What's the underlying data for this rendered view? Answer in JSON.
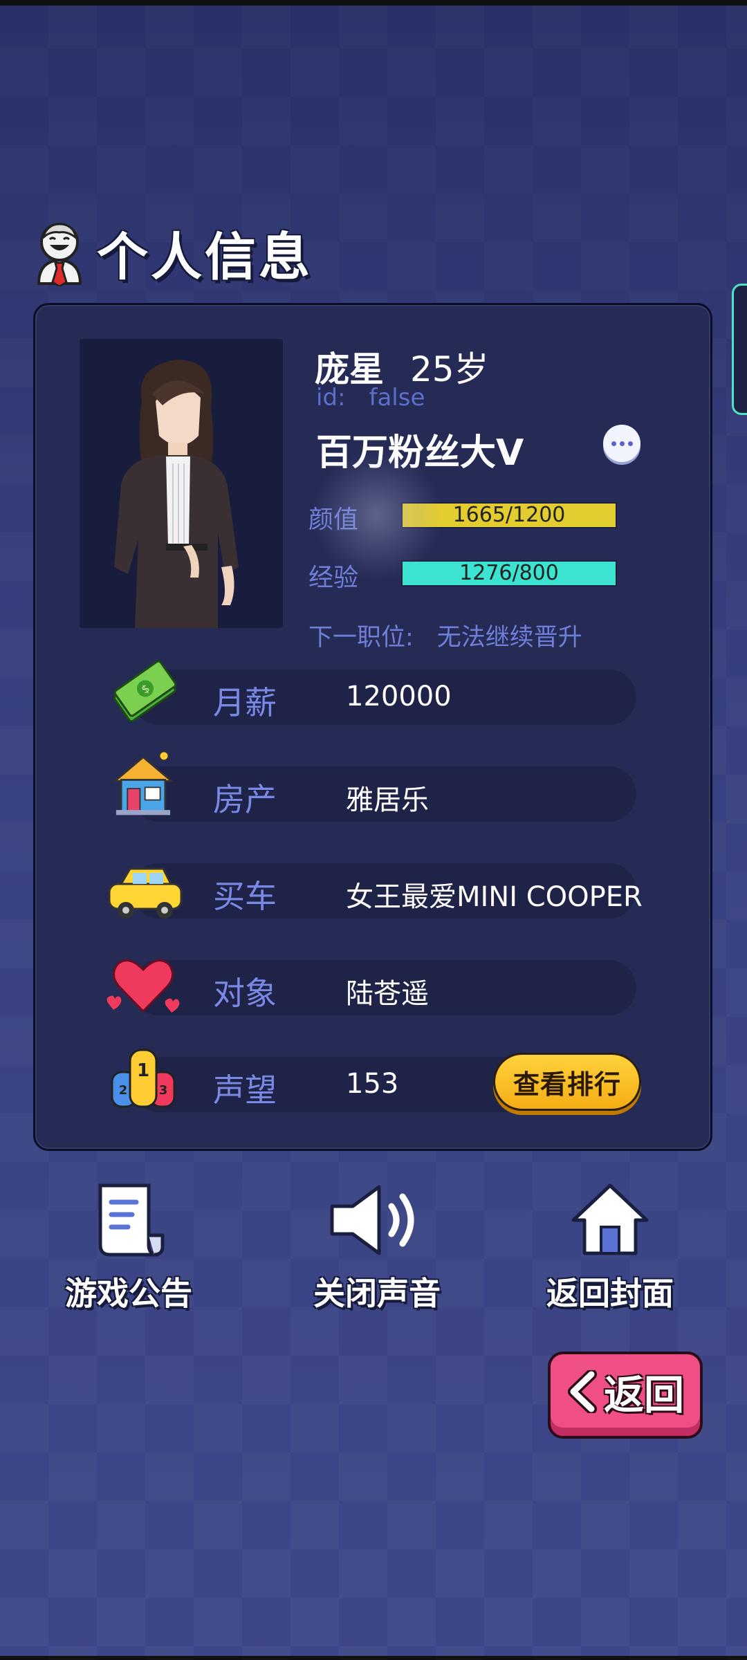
{
  "header": {
    "title": "个人信息"
  },
  "profile": {
    "name": "庞星",
    "age": "25岁",
    "id_label": "id:",
    "id_value": "false",
    "rank_title": "百万粉丝大V",
    "stats": [
      {
        "label": "颜值",
        "text": "1665/1200",
        "fill": 1.0,
        "color": "#e3cc2f"
      },
      {
        "label": "经验",
        "text": "1276/800",
        "fill": 1.0,
        "color": "#3be3d0"
      }
    ],
    "next_position_label": "下一职位:",
    "next_position_value": "无法继续晋升"
  },
  "rows": [
    {
      "label": "月薪",
      "value": "120000",
      "icon": "cash-icon"
    },
    {
      "label": "房产",
      "value": "雅居乐",
      "icon": "house-icon"
    },
    {
      "label": "买车",
      "value": "女王最爱MINI COOPER",
      "icon": "car-icon"
    },
    {
      "label": "对象",
      "value": "陆苍遥",
      "icon": "heart-icon"
    },
    {
      "label": "声望",
      "value": "153",
      "icon": "podium-icon"
    }
  ],
  "rank_button": "查看排行",
  "bottom": {
    "notice": "游戏公告",
    "sound": "关闭声音",
    "home": "返回封面"
  },
  "back_button": "返回",
  "colors": {
    "background": "#3c4585",
    "panel": "#262b55",
    "label": "#7a89e6",
    "back_button": "#ef4f84",
    "rank_button": "#f5ad14"
  }
}
